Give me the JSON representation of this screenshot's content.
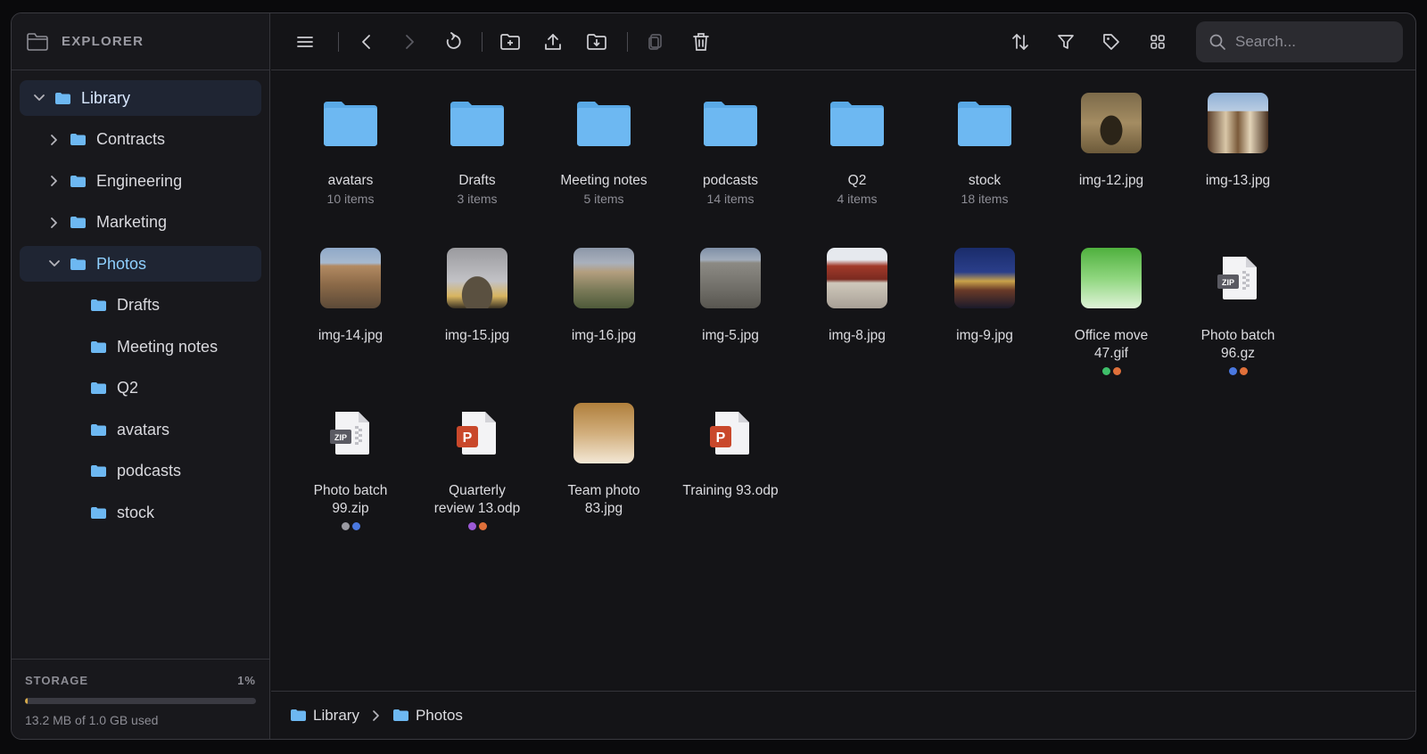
{
  "sidebar": {
    "title": "EXPLORER",
    "tree": [
      {
        "label": "Library",
        "level": 0,
        "expanded": true,
        "selected": true
      },
      {
        "label": "Contracts",
        "level": 1,
        "expanded": false,
        "selected": false
      },
      {
        "label": "Engineering",
        "level": 1,
        "expanded": false,
        "selected": false
      },
      {
        "label": "Marketing",
        "level": 1,
        "expanded": false,
        "selected": false
      },
      {
        "label": "Photos",
        "level": 1,
        "expanded": true,
        "selected": true
      },
      {
        "label": "Drafts",
        "level": 2
      },
      {
        "label": "Meeting notes",
        "level": 2
      },
      {
        "label": "Q2",
        "level": 2
      },
      {
        "label": "avatars",
        "level": 2
      },
      {
        "label": "podcasts",
        "level": 2
      },
      {
        "label": "stock",
        "level": 2
      }
    ],
    "storage": {
      "label": "STORAGE",
      "percent_label": "1%",
      "fraction": 0.013,
      "used_text": "13.2 MB of 1.0 GB used"
    }
  },
  "toolbar": {
    "icons": [
      "menu-icon",
      "back-icon",
      "forward-icon",
      "refresh-icon",
      "new-folder-icon",
      "upload-icon",
      "download-icon",
      "copy-icon",
      "trash-icon",
      "sort-icon",
      "filter-icon",
      "tag-icon",
      "grid-view-icon"
    ],
    "search_placeholder": "Search..."
  },
  "colors": {
    "folder": "#6db8f2",
    "accent": "#8fd0ff",
    "storage_fill": "#d4a84a"
  },
  "items": [
    {
      "name": "avatars",
      "sub": "10 items",
      "kind": "folder"
    },
    {
      "name": "Drafts",
      "sub": "3 items",
      "kind": "folder"
    },
    {
      "name": "Meeting notes",
      "sub": "5 items",
      "kind": "folder"
    },
    {
      "name": "podcasts",
      "sub": "14 items",
      "kind": "folder"
    },
    {
      "name": "Q2",
      "sub": "4 items",
      "kind": "folder"
    },
    {
      "name": "stock",
      "sub": "18 items",
      "kind": "folder"
    },
    {
      "name": "img-12.jpg",
      "kind": "photo",
      "theme": "gate"
    },
    {
      "name": "img-13.jpg",
      "kind": "photo",
      "theme": "timber"
    },
    {
      "name": "img-14.jpg",
      "kind": "photo",
      "theme": "town"
    },
    {
      "name": "img-15.jpg",
      "kind": "photo",
      "theme": "dome"
    },
    {
      "name": "img-16.jpg",
      "kind": "photo",
      "theme": "hill"
    },
    {
      "name": "img-5.jpg",
      "kind": "photo",
      "theme": "wall"
    },
    {
      "name": "img-8.jpg",
      "kind": "photo",
      "theme": "palace"
    },
    {
      "name": "img-9.jpg",
      "kind": "photo",
      "theme": "night"
    },
    {
      "name": "Office move 47.gif",
      "kind": "gradient",
      "theme": "green",
      "tags": [
        "#3fbf6a",
        "#e0703a"
      ]
    },
    {
      "name": "Photo batch 96.gz",
      "kind": "zip",
      "tags": [
        "#4a78e0",
        "#e0703a"
      ]
    },
    {
      "name": "Photo batch 99.zip",
      "kind": "zip",
      "tags": [
        "#9a9aa2",
        "#4a78e0"
      ]
    },
    {
      "name": "Quarterly review 13.odp",
      "kind": "ppt",
      "tags": [
        "#9b59d6",
        "#e0703a"
      ]
    },
    {
      "name": "Team photo 83.jpg",
      "kind": "gradient",
      "theme": "tan"
    },
    {
      "name": "Training 93.odp",
      "kind": "ppt"
    }
  ],
  "breadcrumb": [
    "Library",
    "Photos"
  ]
}
